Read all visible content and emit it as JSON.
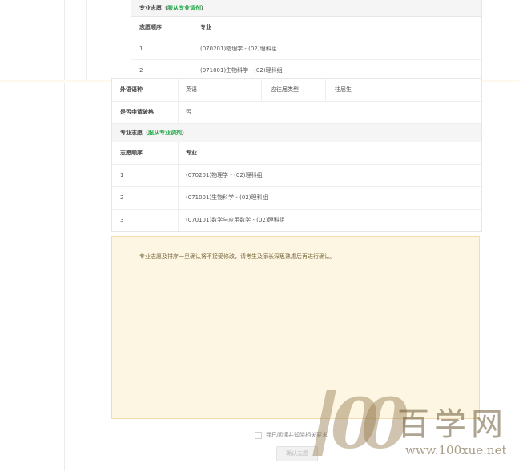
{
  "ghost": {
    "section_title": "专业志愿",
    "section_paren_open": "（",
    "section_green": "服从专业调剂",
    "section_paren_close": "）",
    "col_order": "志愿顺序",
    "col_major": "专业",
    "rows": [
      {
        "order": "1",
        "major": "(070201)物理学 - (02)理科组"
      },
      {
        "order": "2",
        "major": "(071001)生物科学 - (02)理科组"
      }
    ]
  },
  "info": {
    "foreign_language_label": "外语语种",
    "foreign_language_value": "英语",
    "grad_type_label": "应往届类型",
    "grad_type_value": "往届生",
    "breaker_label": "是否申请破格",
    "breaker_value": "否"
  },
  "choices": {
    "section_title": "专业志愿",
    "section_paren_open": "（",
    "section_green": "服从专业调剂",
    "section_paren_close": "）",
    "col_order": "志愿顺序",
    "col_major": "专业",
    "rows": [
      {
        "order": "1",
        "major": "(070201)物理学 - (02)理科组"
      },
      {
        "order": "2",
        "major": "(071001)生物科学 - (02)理科组"
      },
      {
        "order": "3",
        "major": "(070101)数学与应用数学 - (02)理科组"
      }
    ]
  },
  "notice": {
    "text": "专业志愿及排序一旦确认将不接受修改，请考生及家长深思熟虑后再进行确认。"
  },
  "agree_label": "我已阅读并知晓相关要求",
  "confirm_button": "确认志愿",
  "watermark": {
    "digits": "100",
    "brand": "百学网",
    "url": "www.100xue.net"
  }
}
